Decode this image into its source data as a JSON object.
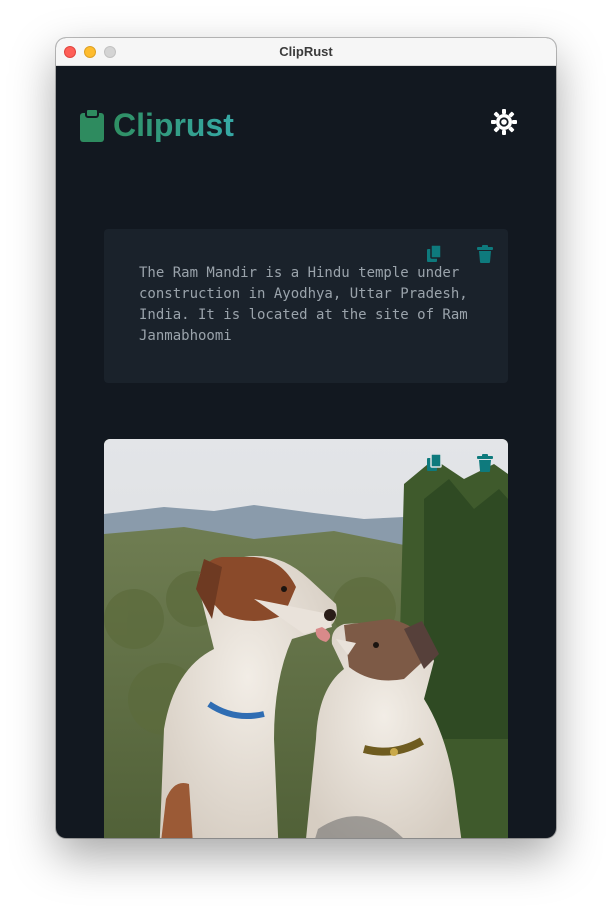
{
  "window": {
    "title": "ClipRust",
    "controls": [
      "close",
      "minimize",
      "zoom"
    ]
  },
  "app": {
    "brand_name": "Cliprust",
    "brand_icon": "clipboard-icon",
    "theme_toggle_icon": "sun-icon"
  },
  "colors": {
    "background": "#121820",
    "card": "#1a222b",
    "accent_start": "#2f8f63",
    "accent_end": "#36a9a6",
    "action_icon": "#0e7a7d"
  },
  "clips": [
    {
      "type": "text",
      "text": "The Ram Mandir is a Hindu temple under\nconstruction in Ayodhya, Uttar Pradesh,\nIndia. It is located at the site of Ram\nJanmabhoomi",
      "actions": [
        "copy-icon",
        "delete-icon"
      ]
    },
    {
      "type": "image",
      "description_icon": "image-clip",
      "actions": [
        "copy-icon",
        "delete-icon"
      ]
    }
  ]
}
